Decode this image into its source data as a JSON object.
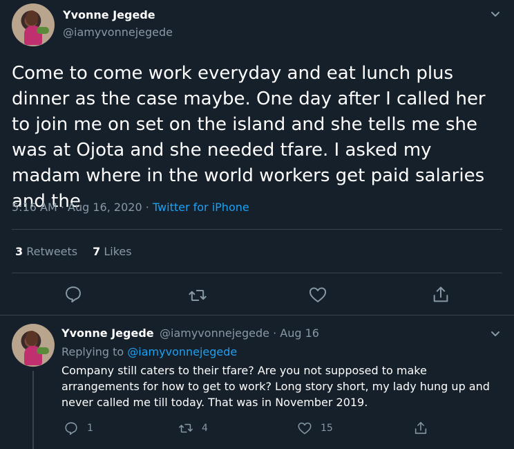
{
  "tweet": {
    "author_name": "Yvonne Jegede",
    "author_handle": "@iamyvonnejegede",
    "text": "Come to come work everyday and eat lunch plus dinner as the case maybe. One day after I called her to join me on set on the island and she tells me she was at Ojota and she needed tfare. I asked my madam where in the world workers get paid salaries and the",
    "time": "5:16 AM",
    "date": "Aug 16, 2020",
    "dot": "·",
    "source": "Twitter for iPhone",
    "retweets_count": "3",
    "retweets_label": "Retweets",
    "likes_count": "7",
    "likes_label": "Likes",
    "actions": [
      "reply-icon",
      "retweet-icon",
      "like-icon",
      "share-icon"
    ]
  },
  "reply": {
    "author_name": "Yvonne Jegede",
    "author_handle": "@iamyvonnejegede",
    "dot": "·",
    "date": "Aug 16",
    "replying_to_label": "Replying to",
    "replying_to_handle": "@iamyvonnejegede",
    "text": "Company still caters to their tfare? Are you not supposed to make arrangements for how to get to work? Long story short, my lady hung up and never called me till today. That was in  November 2019.",
    "reply_count": "1",
    "retweet_count": "4",
    "like_count": "15"
  },
  "colors": {
    "background": "#15202b",
    "text": "#ffffff",
    "secondary": "#8899a6",
    "accent": "#1da1f2",
    "divider": "#38444d"
  }
}
